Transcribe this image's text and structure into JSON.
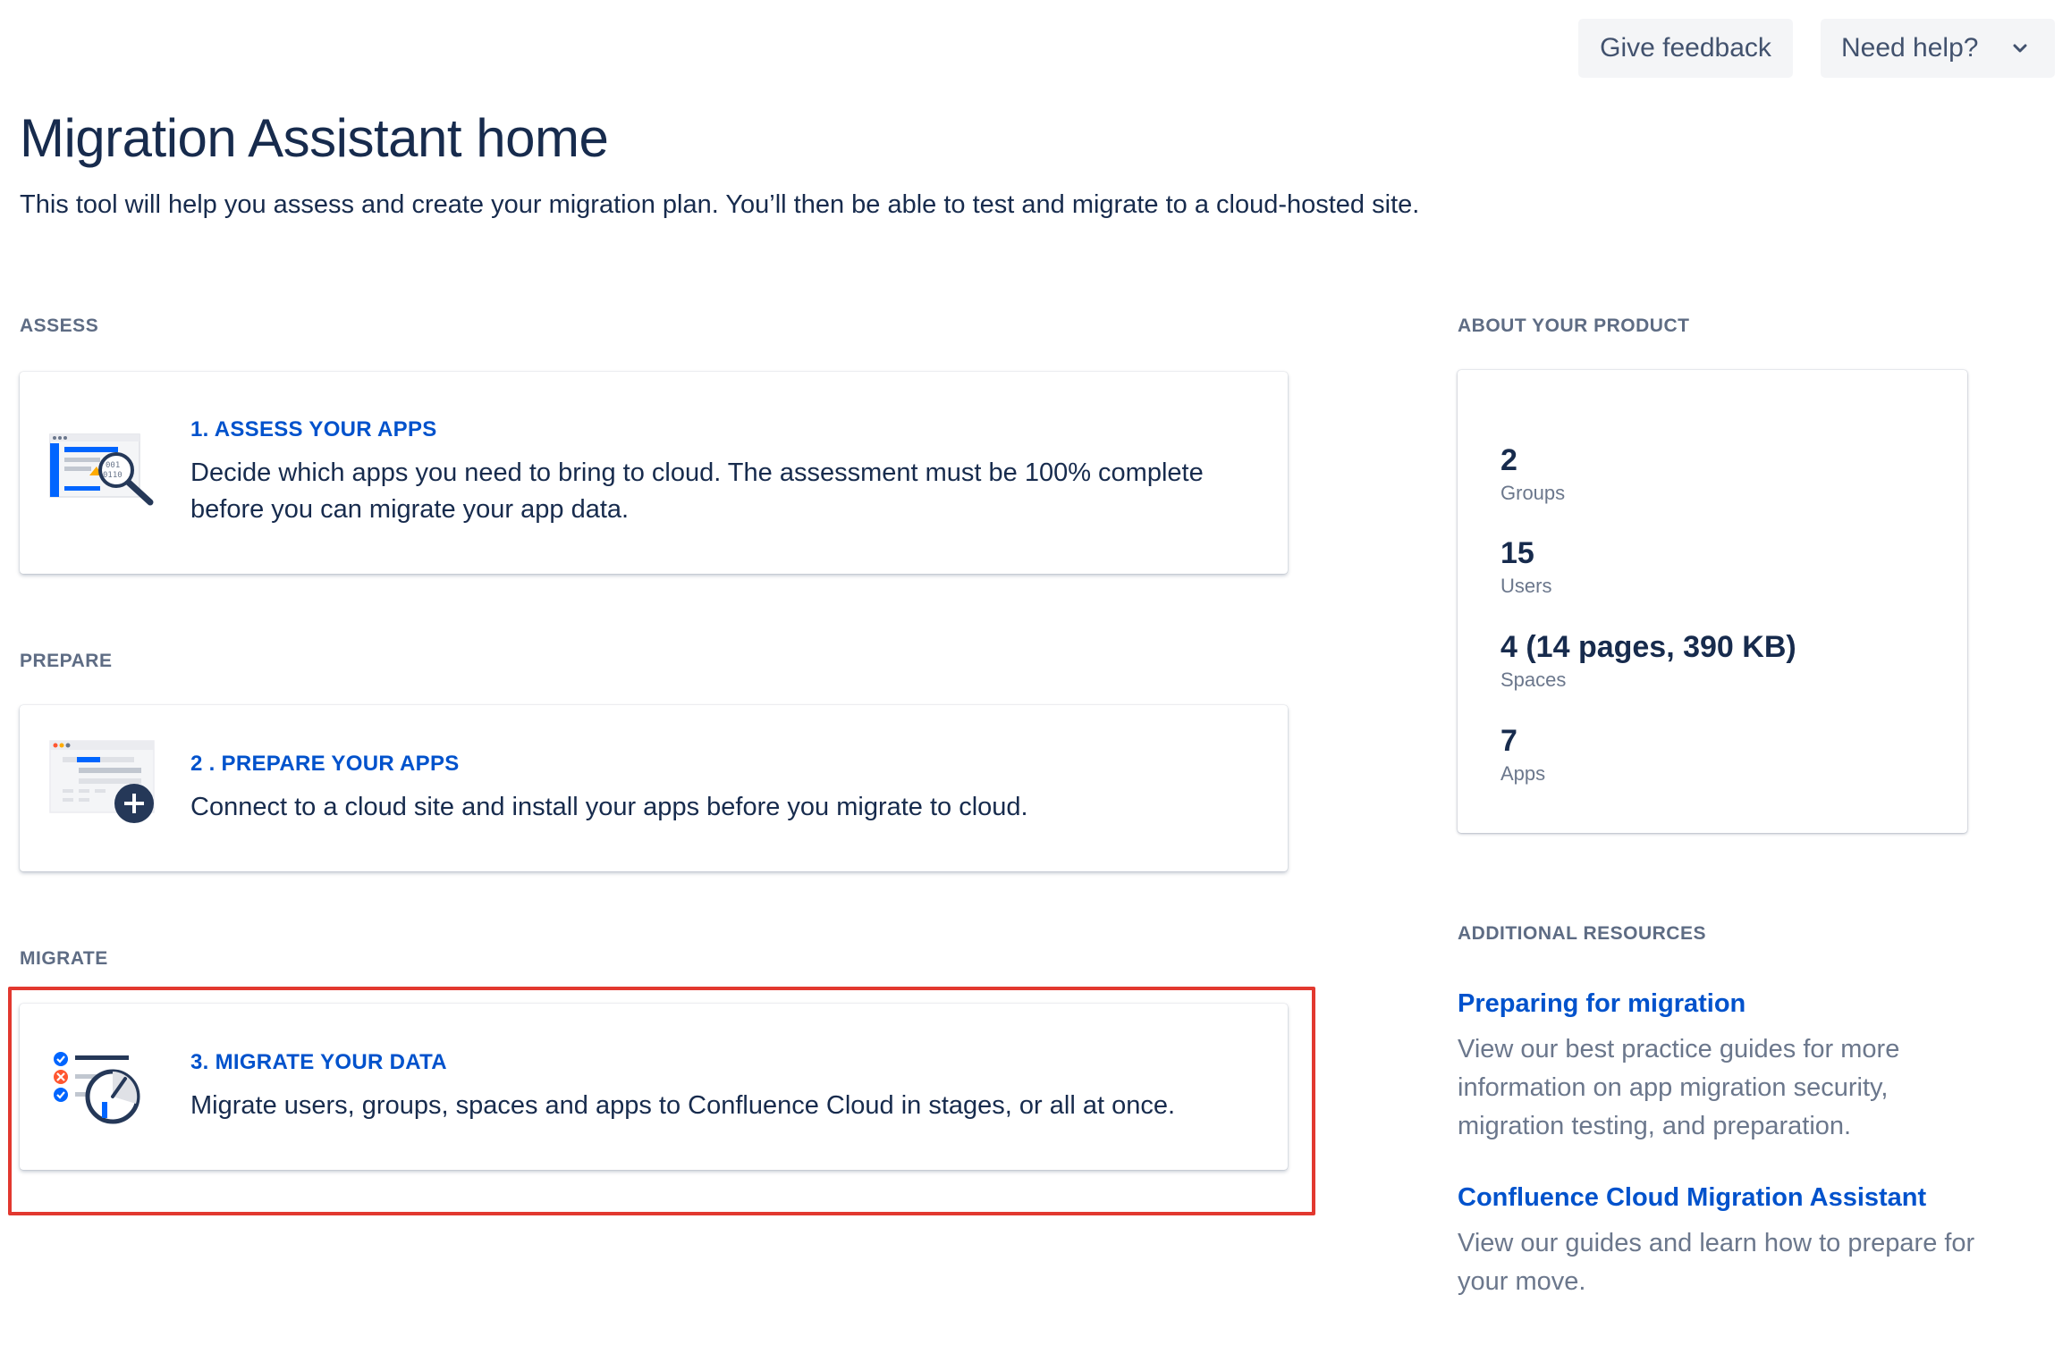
{
  "header": {
    "feedback_label": "Give feedback",
    "help_label": "Need help?"
  },
  "page": {
    "title": "Migration Assistant home",
    "description": "This tool will help you assess and create your migration plan. You’ll then be able to test and migrate to a cloud-hosted site."
  },
  "sections": {
    "assess": {
      "label": "ASSESS",
      "card_title": "1. ASSESS YOUR APPS",
      "card_text": "Decide which apps you need to bring to cloud. The assessment must be 100% complete before you can migrate your app data.",
      "icon": "assess-apps-illustration"
    },
    "prepare": {
      "label": "PREPARE",
      "card_title": "2 . PREPARE YOUR APPS",
      "card_text": "Connect to a cloud site and install your apps before you migrate to cloud.",
      "icon": "prepare-apps-illustration"
    },
    "migrate": {
      "label": "MIGRATE",
      "card_title": "3. MIGRATE YOUR DATA",
      "card_text": "Migrate users, groups, spaces and apps to Confluence Cloud in stages, or all at once.",
      "icon": "migrate-data-illustration"
    }
  },
  "product": {
    "label": "ABOUT YOUR PRODUCT",
    "stats": [
      {
        "value": "2",
        "label": "Groups"
      },
      {
        "value": "15",
        "label": "Users"
      },
      {
        "value": "4 (14 pages, 390 KB)",
        "label": "Spaces"
      },
      {
        "value": "7",
        "label": "Apps"
      }
    ]
  },
  "resources": {
    "label": "ADDITIONAL RESOURCES",
    "items": [
      {
        "title": "Preparing for migration",
        "text": "View our best practice guides for more information on app migration security, migration testing, and preparation."
      },
      {
        "title": "Confluence Cloud Migration Assistant",
        "text": "View our guides and learn how to prepare for your move."
      }
    ]
  },
  "colors": {
    "link": "#0052cc",
    "text": "#172b4d",
    "subtle": "#6b778c",
    "highlight_border": "#e2382f"
  }
}
